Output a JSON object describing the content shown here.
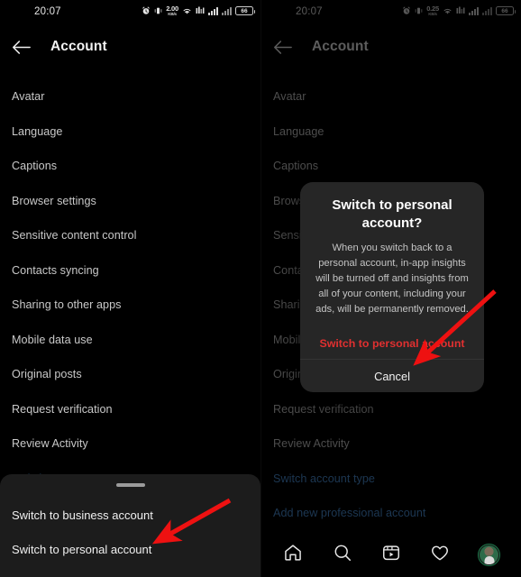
{
  "left": {
    "status_bar": {
      "time": "20:07",
      "net_speed_value": "2.00",
      "net_speed_unit": "KB/s",
      "battery_level": "66",
      "icons": [
        "alarm-icon",
        "vibrate-icon",
        "network-speed",
        "wifi-icon",
        "sim-signal-icon",
        "signal-bars-1",
        "signal-bars-2",
        "battery-icon"
      ]
    },
    "header": {
      "title": "Account",
      "back_icon": "back-arrow-icon"
    },
    "list_items": [
      {
        "label": "Avatar",
        "type": "normal"
      },
      {
        "label": "Language",
        "type": "normal"
      },
      {
        "label": "Captions",
        "type": "normal"
      },
      {
        "label": "Browser settings",
        "type": "normal"
      },
      {
        "label": "Sensitive content control",
        "type": "normal"
      },
      {
        "label": "Contacts syncing",
        "type": "normal"
      },
      {
        "label": "Sharing to other apps",
        "type": "normal"
      },
      {
        "label": "Mobile data use",
        "type": "normal"
      },
      {
        "label": "Original posts",
        "type": "normal"
      },
      {
        "label": "Request verification",
        "type": "normal"
      },
      {
        "label": "Review Activity",
        "type": "normal"
      },
      {
        "label": "Switch account type",
        "type": "link"
      }
    ],
    "sheet": {
      "handle": "drag-handle",
      "options": [
        "Switch to business account",
        "Switch to personal account"
      ]
    },
    "annotation": {
      "arrow": "red-arrow-pointing-to-switch-to-personal-account"
    }
  },
  "right": {
    "status_bar": {
      "time": "20:07",
      "net_speed_value": "0.25",
      "net_speed_unit": "KB/s",
      "battery_level": "66"
    },
    "header": {
      "title": "Account",
      "back_icon": "back-arrow-icon"
    },
    "list_items": [
      {
        "label": "Avatar",
        "type": "normal"
      },
      {
        "label": "Language",
        "type": "normal"
      },
      {
        "label": "Captions",
        "type": "normal"
      },
      {
        "label": "Browser settings",
        "type": "normal"
      },
      {
        "label": "Sensitive content control",
        "type": "normal"
      },
      {
        "label": "Contacts syncing",
        "type": "normal"
      },
      {
        "label": "Sharing to other apps",
        "type": "normal"
      },
      {
        "label": "Mobile data use",
        "type": "normal"
      },
      {
        "label": "Original posts",
        "type": "normal"
      },
      {
        "label": "Request verification",
        "type": "normal"
      },
      {
        "label": "Review Activity",
        "type": "normal"
      },
      {
        "label": "Switch account type",
        "type": "link"
      },
      {
        "label": "Add new professional account",
        "type": "link"
      }
    ],
    "dialog": {
      "title": "Switch to personal account?",
      "body": "When you switch back to a personal account, in-app insights will be turned off and insights from all of your content, including your ads, will be permanently removed.",
      "confirm_label": "Switch to personal account",
      "cancel_label": "Cancel",
      "confirm_color": "#e03030"
    },
    "bottom_nav": [
      {
        "icon": "home-icon",
        "label": "Home"
      },
      {
        "icon": "search-icon",
        "label": "Search"
      },
      {
        "icon": "reels-icon",
        "label": "Reels"
      },
      {
        "icon": "heart-icon",
        "label": "Activity"
      },
      {
        "icon": "profile-avatar-icon",
        "label": "Profile"
      }
    ],
    "annotation": {
      "arrow": "red-arrow-pointing-to-switch-to-personal-account"
    }
  },
  "theme": {
    "background": "#000000",
    "text_primary": "#f2f2f2",
    "text_secondary": "#c9c9c9",
    "link": "#4a8fd6",
    "sheet_background": "#1c1c1c",
    "dialog_background": "#262626",
    "annotation_red": "#ee1111"
  }
}
